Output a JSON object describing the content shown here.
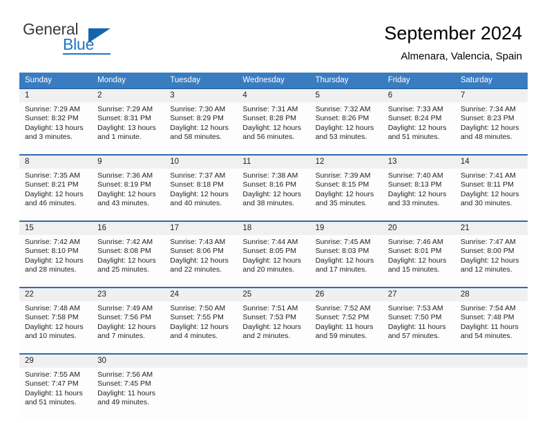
{
  "brand": {
    "name_top": "General",
    "name_bottom": "Blue",
    "accent_color": "#1d76c4"
  },
  "header": {
    "title": "September 2024",
    "location": "Almenara, Valencia, Spain"
  },
  "theme": {
    "header_row_bg": "#3a7cc0",
    "row_divider": "#2b6cad",
    "daynum_bg": "#f0f0f0"
  },
  "weekdays": [
    "Sunday",
    "Monday",
    "Tuesday",
    "Wednesday",
    "Thursday",
    "Friday",
    "Saturday"
  ],
  "weeks": [
    [
      {
        "day": "1",
        "sunrise": "Sunrise: 7:29 AM",
        "sunset": "Sunset: 8:32 PM",
        "daylight1": "Daylight: 13 hours",
        "daylight2": "and 3 minutes."
      },
      {
        "day": "2",
        "sunrise": "Sunrise: 7:29 AM",
        "sunset": "Sunset: 8:31 PM",
        "daylight1": "Daylight: 13 hours",
        "daylight2": "and 1 minute."
      },
      {
        "day": "3",
        "sunrise": "Sunrise: 7:30 AM",
        "sunset": "Sunset: 8:29 PM",
        "daylight1": "Daylight: 12 hours",
        "daylight2": "and 58 minutes."
      },
      {
        "day": "4",
        "sunrise": "Sunrise: 7:31 AM",
        "sunset": "Sunset: 8:28 PM",
        "daylight1": "Daylight: 12 hours",
        "daylight2": "and 56 minutes."
      },
      {
        "day": "5",
        "sunrise": "Sunrise: 7:32 AM",
        "sunset": "Sunset: 8:26 PM",
        "daylight1": "Daylight: 12 hours",
        "daylight2": "and 53 minutes."
      },
      {
        "day": "6",
        "sunrise": "Sunrise: 7:33 AM",
        "sunset": "Sunset: 8:24 PM",
        "daylight1": "Daylight: 12 hours",
        "daylight2": "and 51 minutes."
      },
      {
        "day": "7",
        "sunrise": "Sunrise: 7:34 AM",
        "sunset": "Sunset: 8:23 PM",
        "daylight1": "Daylight: 12 hours",
        "daylight2": "and 48 minutes."
      }
    ],
    [
      {
        "day": "8",
        "sunrise": "Sunrise: 7:35 AM",
        "sunset": "Sunset: 8:21 PM",
        "daylight1": "Daylight: 12 hours",
        "daylight2": "and 46 minutes."
      },
      {
        "day": "9",
        "sunrise": "Sunrise: 7:36 AM",
        "sunset": "Sunset: 8:19 PM",
        "daylight1": "Daylight: 12 hours",
        "daylight2": "and 43 minutes."
      },
      {
        "day": "10",
        "sunrise": "Sunrise: 7:37 AM",
        "sunset": "Sunset: 8:18 PM",
        "daylight1": "Daylight: 12 hours",
        "daylight2": "and 40 minutes."
      },
      {
        "day": "11",
        "sunrise": "Sunrise: 7:38 AM",
        "sunset": "Sunset: 8:16 PM",
        "daylight1": "Daylight: 12 hours",
        "daylight2": "and 38 minutes."
      },
      {
        "day": "12",
        "sunrise": "Sunrise: 7:39 AM",
        "sunset": "Sunset: 8:15 PM",
        "daylight1": "Daylight: 12 hours",
        "daylight2": "and 35 minutes."
      },
      {
        "day": "13",
        "sunrise": "Sunrise: 7:40 AM",
        "sunset": "Sunset: 8:13 PM",
        "daylight1": "Daylight: 12 hours",
        "daylight2": "and 33 minutes."
      },
      {
        "day": "14",
        "sunrise": "Sunrise: 7:41 AM",
        "sunset": "Sunset: 8:11 PM",
        "daylight1": "Daylight: 12 hours",
        "daylight2": "and 30 minutes."
      }
    ],
    [
      {
        "day": "15",
        "sunrise": "Sunrise: 7:42 AM",
        "sunset": "Sunset: 8:10 PM",
        "daylight1": "Daylight: 12 hours",
        "daylight2": "and 28 minutes."
      },
      {
        "day": "16",
        "sunrise": "Sunrise: 7:42 AM",
        "sunset": "Sunset: 8:08 PM",
        "daylight1": "Daylight: 12 hours",
        "daylight2": "and 25 minutes."
      },
      {
        "day": "17",
        "sunrise": "Sunrise: 7:43 AM",
        "sunset": "Sunset: 8:06 PM",
        "daylight1": "Daylight: 12 hours",
        "daylight2": "and 22 minutes."
      },
      {
        "day": "18",
        "sunrise": "Sunrise: 7:44 AM",
        "sunset": "Sunset: 8:05 PM",
        "daylight1": "Daylight: 12 hours",
        "daylight2": "and 20 minutes."
      },
      {
        "day": "19",
        "sunrise": "Sunrise: 7:45 AM",
        "sunset": "Sunset: 8:03 PM",
        "daylight1": "Daylight: 12 hours",
        "daylight2": "and 17 minutes."
      },
      {
        "day": "20",
        "sunrise": "Sunrise: 7:46 AM",
        "sunset": "Sunset: 8:01 PM",
        "daylight1": "Daylight: 12 hours",
        "daylight2": "and 15 minutes."
      },
      {
        "day": "21",
        "sunrise": "Sunrise: 7:47 AM",
        "sunset": "Sunset: 8:00 PM",
        "daylight1": "Daylight: 12 hours",
        "daylight2": "and 12 minutes."
      }
    ],
    [
      {
        "day": "22",
        "sunrise": "Sunrise: 7:48 AM",
        "sunset": "Sunset: 7:58 PM",
        "daylight1": "Daylight: 12 hours",
        "daylight2": "and 10 minutes."
      },
      {
        "day": "23",
        "sunrise": "Sunrise: 7:49 AM",
        "sunset": "Sunset: 7:56 PM",
        "daylight1": "Daylight: 12 hours",
        "daylight2": "and 7 minutes."
      },
      {
        "day": "24",
        "sunrise": "Sunrise: 7:50 AM",
        "sunset": "Sunset: 7:55 PM",
        "daylight1": "Daylight: 12 hours",
        "daylight2": "and 4 minutes."
      },
      {
        "day": "25",
        "sunrise": "Sunrise: 7:51 AM",
        "sunset": "Sunset: 7:53 PM",
        "daylight1": "Daylight: 12 hours",
        "daylight2": "and 2 minutes."
      },
      {
        "day": "26",
        "sunrise": "Sunrise: 7:52 AM",
        "sunset": "Sunset: 7:52 PM",
        "daylight1": "Daylight: 11 hours",
        "daylight2": "and 59 minutes."
      },
      {
        "day": "27",
        "sunrise": "Sunrise: 7:53 AM",
        "sunset": "Sunset: 7:50 PM",
        "daylight1": "Daylight: 11 hours",
        "daylight2": "and 57 minutes."
      },
      {
        "day": "28",
        "sunrise": "Sunrise: 7:54 AM",
        "sunset": "Sunset: 7:48 PM",
        "daylight1": "Daylight: 11 hours",
        "daylight2": "and 54 minutes."
      }
    ],
    [
      {
        "day": "29",
        "sunrise": "Sunrise: 7:55 AM",
        "sunset": "Sunset: 7:47 PM",
        "daylight1": "Daylight: 11 hours",
        "daylight2": "and 51 minutes."
      },
      {
        "day": "30",
        "sunrise": "Sunrise: 7:56 AM",
        "sunset": "Sunset: 7:45 PM",
        "daylight1": "Daylight: 11 hours",
        "daylight2": "and 49 minutes."
      },
      {
        "day": "",
        "sunrise": "",
        "sunset": "",
        "daylight1": "",
        "daylight2": ""
      },
      {
        "day": "",
        "sunrise": "",
        "sunset": "",
        "daylight1": "",
        "daylight2": ""
      },
      {
        "day": "",
        "sunrise": "",
        "sunset": "",
        "daylight1": "",
        "daylight2": ""
      },
      {
        "day": "",
        "sunrise": "",
        "sunset": "",
        "daylight1": "",
        "daylight2": ""
      },
      {
        "day": "",
        "sunrise": "",
        "sunset": "",
        "daylight1": "",
        "daylight2": ""
      }
    ]
  ]
}
